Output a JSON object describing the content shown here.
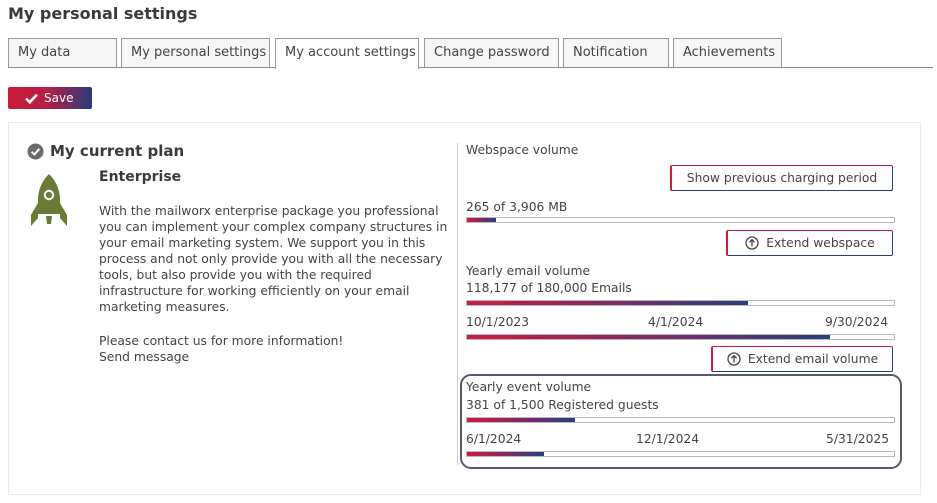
{
  "page": {
    "title": "My personal settings"
  },
  "tabs": [
    {
      "label": "My data",
      "active": false
    },
    {
      "label": "My personal settings",
      "active": false
    },
    {
      "label": "My account settings",
      "active": true
    },
    {
      "label": "Change password",
      "active": false
    },
    {
      "label": "Notification",
      "active": false
    },
    {
      "label": "Achievements",
      "active": false
    }
  ],
  "toolbar": {
    "save_label": "Save"
  },
  "plan": {
    "section_title": "My current plan",
    "name": "Enterprise",
    "description": "With the mailworx enterprise package you professional you can implement your complex company structures in your email marketing system. We support you in this process and not only provide you with all the necessary tools, but also provide you with the required infrastructure for working efficiently on your email marketing measures.",
    "contact_text": "Please contact us for more information!",
    "send_message_label": "Send message"
  },
  "colors": {
    "brand_red": "#d4183a",
    "brand_navy": "#24407f",
    "rocket": "#6b7a35"
  },
  "usage": {
    "webspace": {
      "label": "Webspace volume",
      "show_previous_label": "Show previous charging period",
      "usage_text": "265 of 3,906 MB",
      "fill_fraction": 0.068,
      "extend_label": "Extend webspace"
    },
    "email": {
      "label": "Yearly email volume",
      "usage_text": "118,177 of 180,000 Emails",
      "fill_fraction": 0.657,
      "period_start": "10/1/2023",
      "period_mid": "4/1/2024",
      "period_end": "9/30/2024",
      "period_fraction": 0.85,
      "extend_label": "Extend email volume"
    },
    "event": {
      "label": "Yearly event volume",
      "usage_text": "381 of 1,500 Registered guests",
      "fill_fraction": 0.254,
      "period_start": "6/1/2024",
      "period_mid": "12/1/2024",
      "period_end": "5/31/2025",
      "period_fraction": 0.18
    }
  }
}
